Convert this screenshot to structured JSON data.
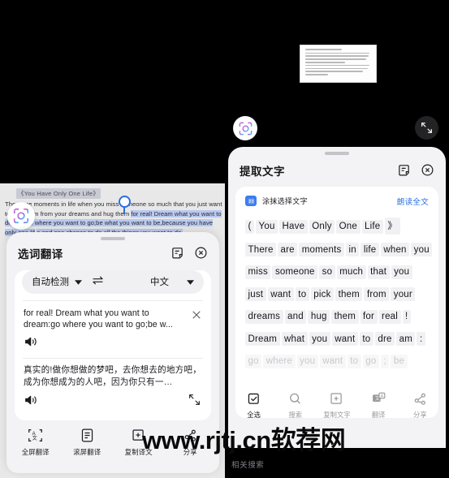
{
  "left_panel": {
    "document": {
      "title": "《You Have Only One Life》",
      "line1_plain": "There are moments in life when you miss someone so much that you just want",
      "line2_pre": "to pick them from your dreams and hug them ",
      "line2_hl": "for real! Dream what you want to dre",
      "line3_hl": "am;go where you want to go;be what you want to be,because you have only one lif",
      "line4_hl": "e and one chance to do all the things you want to do."
    },
    "sheet": {
      "title": "选词翻译",
      "edit_icon": "edit-note-icon",
      "close_icon": "close-circle-icon",
      "source_language": "自动检测",
      "target_language": "中文",
      "swap_icon": "swap-languages-icon",
      "source_text": "for real! Dream what you want to dream:go where you want to go;be w...",
      "translated_text": "真实的!做你想做的梦吧，去你想去的地方吧，成为你想成为的人吧，因为你只有一…",
      "speaker_icon": "speaker-icon",
      "clear_icon": "clear-x-icon",
      "expand_icon": "expand-diagonal-icon",
      "tools": [
        {
          "label": "全屏翻译",
          "icon": "fullscreen-translate-icon"
        },
        {
          "label": "滚屏翻译",
          "icon": "scroll-translate-icon"
        },
        {
          "label": "复制译文",
          "icon": "copy-translation-icon"
        },
        {
          "label": "分享",
          "icon": "share-icon"
        }
      ]
    },
    "lens_icon": "lens-scan-icon"
  },
  "right_panel": {
    "lens_icon": "lens-scan-icon",
    "expand_icon": "expand-fullscreen-icon",
    "thumbnail": "document-preview-thumbnail",
    "sheet": {
      "title": "提取文字",
      "edit_icon": "edit-note-icon",
      "close_icon": "close-circle-icon",
      "smear_select_label": "涂抹选择文字",
      "smear_icon": "smear-select-icon",
      "read_all_label": "朗读全文",
      "ocr_lines": [
        {
          "faded": false,
          "words": [
            "(",
            "You",
            "Have",
            "Only",
            "One",
            "Life",
            "》"
          ]
        },
        {
          "faded": false,
          "words": [
            "There",
            "are",
            "moments",
            "in",
            "life",
            "when",
            "you"
          ]
        },
        {
          "faded": false,
          "words": [
            "miss",
            "someone",
            "so",
            "much",
            "that",
            "you"
          ]
        },
        {
          "faded": false,
          "words": [
            "just",
            "want",
            "to",
            "pick",
            "them",
            "from",
            "your"
          ]
        },
        {
          "faded": false,
          "words": [
            "dreams",
            "and",
            "hug",
            "them",
            "for",
            "real",
            "!"
          ]
        },
        {
          "faded": false,
          "words": [
            "Dream",
            "what",
            "you",
            "want",
            "to",
            "dre",
            "am",
            ":"
          ]
        },
        {
          "faded": true,
          "words": [
            "go",
            "where",
            "you",
            "want",
            "to",
            "go",
            ";",
            "be"
          ]
        }
      ],
      "tools": [
        {
          "label": "全选",
          "icon": "select-all-icon",
          "dim": false
        },
        {
          "label": "搜索",
          "icon": "search-icon",
          "dim": true
        },
        {
          "label": "复制文字",
          "icon": "copy-text-icon",
          "dim": true
        },
        {
          "label": "翻译",
          "icon": "translate-icon",
          "dim": true
        },
        {
          "label": "分享",
          "icon": "share-icon",
          "dim": true
        }
      ]
    },
    "related_search_label": "相关搜索"
  },
  "watermark": {
    "text": "www.rjtj.cn软荐网"
  },
  "colors": {
    "accent_blue": "#2a6fe0",
    "selection_blue": "#b9c9f0",
    "sheet_bg": "#f3f3f5"
  }
}
